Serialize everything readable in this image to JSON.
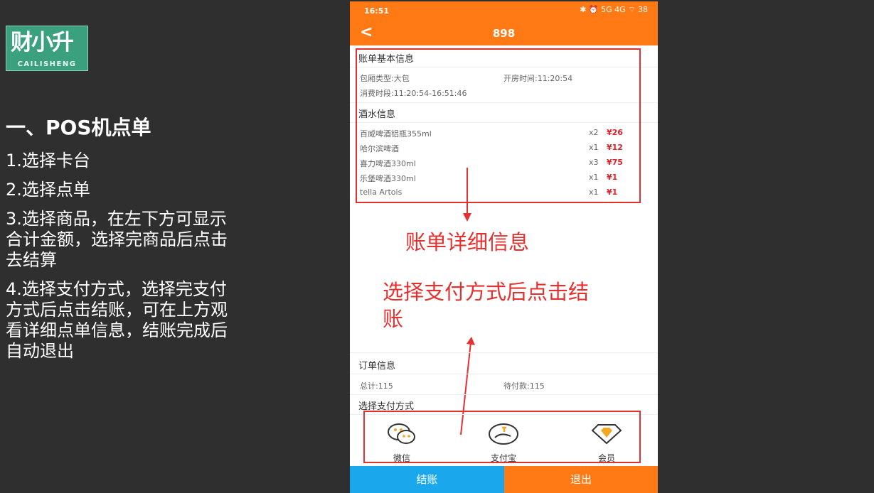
{
  "logo": {
    "mark": "财小升",
    "sub": "CAILISHENG"
  },
  "left": {
    "heading": "一、POS机点单",
    "steps": [
      "1.选择卡台",
      "2.选择点单",
      "3.选择商品，在左下方可显示合计金额，选择完商品后点击去结算",
      "4.选择支付方式，选择完支付方式后点击结账，可在上方观看详细点单信息，结账完成后自动退出"
    ]
  },
  "status": {
    "time": "16:51",
    "icons": "✱ ⏰ 5G 4G ⌔ 38"
  },
  "nav": {
    "back": "<",
    "title": "898"
  },
  "bill": {
    "basic_title": "账单基本信息",
    "room_type": "包厢类型:大包",
    "open_time": "开房时间:11:20:54",
    "period": "消费时段:11:20:54-16:51:46",
    "drinks_title": "酒水信息",
    "items": [
      {
        "name": "百威啤酒铝瓶355ml",
        "qty": "x2",
        "price": "¥26"
      },
      {
        "name": "哈尔滨啤酒",
        "qty": "x1",
        "price": "¥12"
      },
      {
        "name": "喜力啤酒330ml",
        "qty": "x3",
        "price": "¥75"
      },
      {
        "name": "乐堡啤酒330ml",
        "qty": "x1",
        "price": "¥1"
      },
      {
        "name": "tella Artois",
        "qty": "x1",
        "price": "¥1"
      }
    ]
  },
  "annotations": {
    "detail": "账单详细信息",
    "pay_line1": "选择支付方式后点击结",
    "pay_line2": "账"
  },
  "order": {
    "title": "订单信息",
    "total": "总计:115",
    "pending": "待付款:115",
    "pay_title": "选择支付方式"
  },
  "pay": {
    "wechat": "微信",
    "alipay": "支付宝",
    "member": "会员"
  },
  "footer": {
    "checkout": "结账",
    "exit": "退出"
  },
  "colors": {
    "orange": "#ff7a15",
    "blue": "#1aa7ec",
    "red": "#e53030"
  }
}
